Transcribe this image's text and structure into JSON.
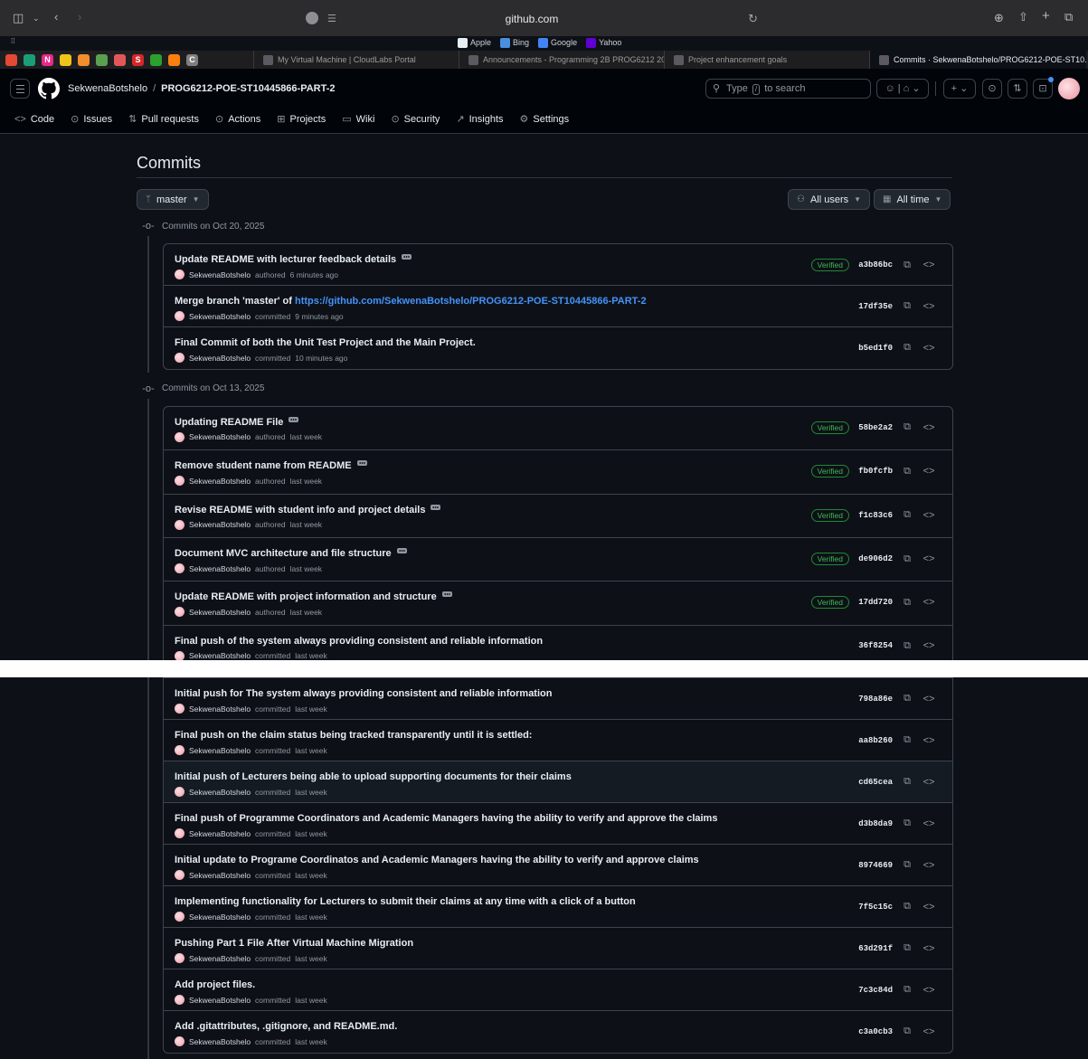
{
  "browser": {
    "address": "github.com",
    "favorites": [
      {
        "label": "Apple",
        "color": "#e6edf3"
      },
      {
        "label": "Bing",
        "color": "#4a8ee0"
      },
      {
        "label": "Google",
        "color": "#4285f4"
      },
      {
        "label": "Yahoo",
        "color": "#6001d2"
      }
    ],
    "pinned_colors": [
      "#e34a33",
      "#1b9e77",
      "#e7298a",
      "#f0c419",
      "#f28e2b",
      "#59a14f",
      "#e15759",
      "#d62728",
      "#2ca02c",
      "#ff7f0e",
      "#7f7f7f"
    ],
    "pinned_letters": [
      "",
      "",
      "N",
      "",
      "",
      "",
      "",
      "S",
      "",
      "",
      "C"
    ],
    "tabs": [
      {
        "title": "My Virtual Machine | CloudLabs Portal",
        "active": false
      },
      {
        "title": "Announcements - Programming 2B PROG6212 202...",
        "active": false
      },
      {
        "title": "Project enhancement goals",
        "active": false
      },
      {
        "title": "Commits · SekwenaBotshelo/PROG6212-POE-ST10...",
        "active": true
      }
    ]
  },
  "header": {
    "owner": "SekwenaBotshelo",
    "separator": "/",
    "repo": "PROG6212-POE-ST10445866-PART-2",
    "search_prefix": "Type",
    "search_key": "/",
    "search_suffix": "to search",
    "nav": [
      {
        "icon": "code-icon",
        "glyph": "<>",
        "label": "Code"
      },
      {
        "icon": "issues-icon",
        "glyph": "⊙",
        "label": "Issues"
      },
      {
        "icon": "pull-request-icon",
        "glyph": "⇅",
        "label": "Pull requests"
      },
      {
        "icon": "actions-icon",
        "glyph": "⊙",
        "label": "Actions"
      },
      {
        "icon": "projects-icon",
        "glyph": "⊞",
        "label": "Projects"
      },
      {
        "icon": "wiki-icon",
        "glyph": "▭",
        "label": "Wiki"
      },
      {
        "icon": "security-icon",
        "glyph": "⊙",
        "label": "Security"
      },
      {
        "icon": "insights-icon",
        "glyph": "↗",
        "label": "Insights"
      },
      {
        "icon": "settings-icon",
        "glyph": "⚙",
        "label": "Settings"
      }
    ]
  },
  "page": {
    "title": "Commits",
    "branch_label": "master",
    "users_label": "All users",
    "time_label": "All time"
  },
  "groups": [
    {
      "label": "Commits on Oct 20, 2025",
      "commits": [
        {
          "message": "Update README with lecturer feedback details",
          "link": "",
          "ellipsis": true,
          "author": "SekwenaBotshelo",
          "action": "authored",
          "time": "6 minutes ago",
          "verified": true,
          "sha": "a3b86bc"
        },
        {
          "message": "Merge branch 'master' of ",
          "link": "https://github.com/SekwenaBotshelo/PROG6212-POE-ST10445866-PART-2",
          "ellipsis": false,
          "author": "SekwenaBotshelo",
          "action": "committed",
          "time": "9 minutes ago",
          "verified": false,
          "sha": "17df35e"
        },
        {
          "message": "Final Commit of both the Unit Test Project and the Main Project.",
          "link": "",
          "ellipsis": false,
          "author": "SekwenaBotshelo",
          "action": "committed",
          "time": "10 minutes ago",
          "verified": false,
          "sha": "b5ed1f0"
        }
      ]
    },
    {
      "label": "Commits on Oct 13, 2025",
      "commits": [
        {
          "message": "Updating README File",
          "link": "",
          "ellipsis": true,
          "author": "SekwenaBotshelo",
          "action": "authored",
          "time": "last week",
          "verified": true,
          "sha": "58be2a2"
        },
        {
          "message": "Remove student name from README",
          "link": "",
          "ellipsis": true,
          "author": "SekwenaBotshelo",
          "action": "authored",
          "time": "last week",
          "verified": true,
          "sha": "fb0fcfb"
        },
        {
          "message": "Revise README with student info and project details",
          "link": "",
          "ellipsis": true,
          "author": "SekwenaBotshelo",
          "action": "authored",
          "time": "last week",
          "verified": true,
          "sha": "f1c83c6"
        },
        {
          "message": "Document MVC architecture and file structure",
          "link": "",
          "ellipsis": true,
          "author": "SekwenaBotshelo",
          "action": "authored",
          "time": "last week",
          "verified": true,
          "sha": "de906d2"
        },
        {
          "message": "Update README with project information and structure",
          "link": "",
          "ellipsis": true,
          "author": "SekwenaBotshelo",
          "action": "authored",
          "time": "last week",
          "verified": true,
          "sha": "17dd720"
        },
        {
          "message": "Final push of the system always providing consistent and reliable information",
          "link": "",
          "ellipsis": false,
          "author": "SekwenaBotshelo",
          "action": "committed",
          "time": "last week",
          "verified": false,
          "sha": "36f8254"
        }
      ]
    }
  ],
  "continued": [
    {
      "message": "Initial push for The system always providing consistent and reliable information",
      "author": "SekwenaBotshelo",
      "action": "committed",
      "time": "last week",
      "sha": "798a86e",
      "highlight": false
    },
    {
      "message": "Final push on the claim status being tracked transparently until it is settled:",
      "author": "SekwenaBotshelo",
      "action": "committed",
      "time": "last week",
      "sha": "aa8b260",
      "highlight": false
    },
    {
      "message": "Initial push of Lecturers being able to upload supporting documents for their claims",
      "author": "SekwenaBotshelo",
      "action": "committed",
      "time": "last week",
      "sha": "cd65cea",
      "highlight": true
    },
    {
      "message": "Final push of Programme Coordinators and Academic Managers having the ability to verify and approve the claims",
      "author": "SekwenaBotshelo",
      "action": "committed",
      "time": "last week",
      "sha": "d3b8da9",
      "highlight": false
    },
    {
      "message": "Initial update to Programe Coordinatos and Academic Managers having the ability to verify and approve claims",
      "author": "SekwenaBotshelo",
      "action": "committed",
      "time": "last week",
      "sha": "8974669",
      "highlight": false
    },
    {
      "message": "Implementing functionality for Lecturers to submit their claims at any time with a click of a button",
      "author": "SekwenaBotshelo",
      "action": "committed",
      "time": "last week",
      "sha": "7f5c15c",
      "highlight": false
    },
    {
      "message": "Pushing Part 1 File After Virtual Machine Migration",
      "author": "SekwenaBotshelo",
      "action": "committed",
      "time": "last week",
      "sha": "63d291f",
      "highlight": false
    },
    {
      "message": "Add project files.",
      "author": "SekwenaBotshelo",
      "action": "committed",
      "time": "last week",
      "sha": "7c3c84d",
      "highlight": false
    },
    {
      "message": "Add .gitattributes, .gitignore, and README.md.",
      "author": "SekwenaBotshelo",
      "action": "committed",
      "time": "last week",
      "sha": "c3a0cb3",
      "highlight": false
    }
  ],
  "labels": {
    "verified": "Verified"
  },
  "colors": {
    "background": "#0d1117",
    "border": "#3d444d",
    "link": "#4493f8",
    "verified": "#3fb950"
  }
}
